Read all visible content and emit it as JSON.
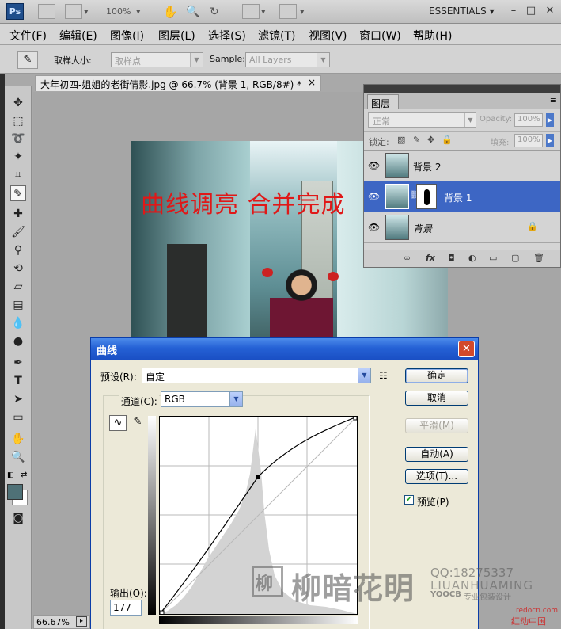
{
  "appbar": {
    "logo": "Ps",
    "zoom_level": "100%",
    "workspace": "ESSENTIALS",
    "window_controls": [
      "–",
      "□",
      "✕"
    ]
  },
  "menu": [
    "文件(F)",
    "编辑(E)",
    "图像(I)",
    "图层(L)",
    "选择(S)",
    "滤镜(T)",
    "视图(V)",
    "窗口(W)",
    "帮助(H)"
  ],
  "options": {
    "sample_size_label": "取样大小:",
    "sample_size_value": "取样点",
    "sample_label": "Sample:",
    "sample_value": "All Layers"
  },
  "document": {
    "tab_title": "大年初四-姐姐的老街倩影.jpg @ 66.7% (背景 1, RGB/8#) *",
    "close": "×",
    "caption": "曲线调亮 合并完成"
  },
  "layers_panel": {
    "tab": "图层",
    "blend_mode": "正常",
    "opacity_label": "Opacity:",
    "opacity_value": "100%",
    "lock_label": "锁定:",
    "fill_label": "填充:",
    "fill_value": "100%",
    "layers": [
      {
        "name": "背景 2",
        "selected": false,
        "has_mask": false,
        "locked": false
      },
      {
        "name": "背景 1",
        "selected": true,
        "has_mask": true,
        "locked": false
      },
      {
        "name": "背景",
        "selected": false,
        "has_mask": false,
        "locked": true
      }
    ],
    "footer_icons": [
      "link-icon",
      "fx-icon",
      "mask-icon",
      "adjustment-icon",
      "group-icon",
      "new-layer-icon",
      "trash-icon"
    ]
  },
  "curves_dialog": {
    "title": "曲线",
    "close": "✕",
    "preset_label": "预设(R):",
    "preset_value": "自定",
    "channel_label": "通道(C):",
    "channel_value": "RGB",
    "buttons": {
      "ok": "确定",
      "cancel": "取消",
      "smooth": "平滑(M)",
      "auto": "自动(A)",
      "options": "选项(T)..."
    },
    "preview_label": "预览(P)",
    "preview_checked": true,
    "output_label": "输出(O):",
    "output_value": "177",
    "curve_point": {
      "input": 128,
      "output": 177
    }
  },
  "status": {
    "zoom": "66.67%"
  },
  "watermark": {
    "big": "柳暗花明",
    "logo": "柳",
    "qq": "QQ:18275337",
    "english": "LIUANHUAMING",
    "yoocb": "YOOCB",
    "tag": "专业包装设计",
    "redocn_url": "redocn.com",
    "redocn_cn": "红动中国"
  },
  "colors": {
    "foreground": "#4f7177",
    "background": "#ffffff",
    "selection_blue": "#3d66c4",
    "dialog_title_blue": "#2561d5",
    "caption_red": "#e01818"
  }
}
